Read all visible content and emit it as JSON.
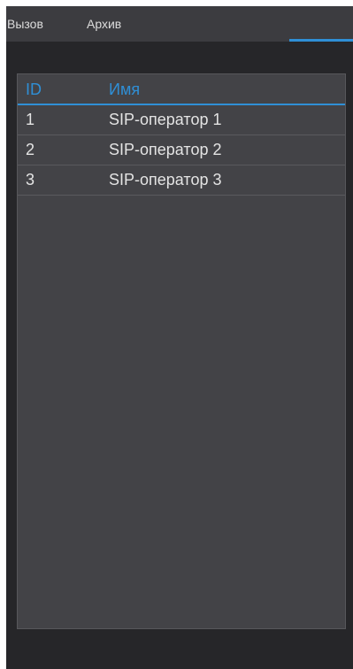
{
  "menubar": {
    "items": [
      {
        "label": "Вызов"
      },
      {
        "label": "Архив"
      }
    ]
  },
  "operators_table": {
    "columns": {
      "id": "ID",
      "name": "Имя"
    },
    "rows": [
      {
        "id": "1",
        "name": "SIP-оператор 1"
      },
      {
        "id": "2",
        "name": "SIP-оператор 2"
      },
      {
        "id": "3",
        "name": "SIP-оператор 3"
      }
    ]
  },
  "colors": {
    "accent": "#2f8fd6",
    "background": "#262629",
    "menubar": "#3c3c40",
    "list_background": "#434347",
    "text": "#e4e4e4"
  }
}
